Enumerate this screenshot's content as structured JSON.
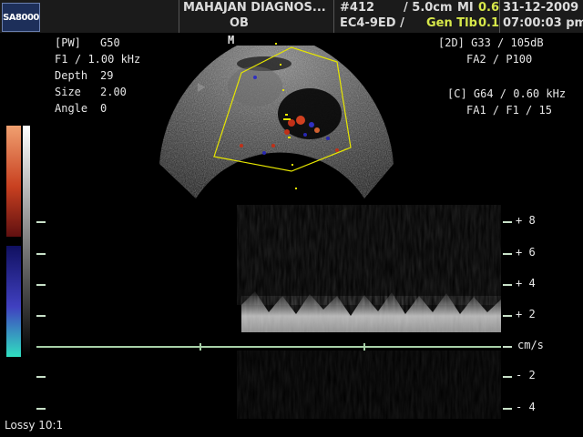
{
  "header": {
    "logo": "SA8000",
    "hospital": "MAHAJAN DIAGNOS...",
    "exam": "OB",
    "frame": "#412",
    "depth_label": "/ 5.0cm",
    "probe": "EC4-9ED /",
    "mi_label": "MI",
    "mi_value": "0.6",
    "tib_label": "Gen Tlb",
    "tib_value": "0.1",
    "date": "31-12-2009",
    "time": "07:00:03 pm"
  },
  "pw_params": [
    {
      "label": "[PW]",
      "value": "G50"
    },
    {
      "label": "F1",
      "value": "/ 1.00 kHz"
    },
    {
      "label": "Depth",
      "value": "29"
    },
    {
      "label": "Size",
      "value": "2.00"
    },
    {
      "label": "Angle",
      "value": "0"
    }
  ],
  "twod_params": {
    "line1": "[2D]  G33 / 105dB",
    "line2": "FA2 / P100"
  },
  "color_params": {
    "line1": "[C]  G64 / 0.60 kHz",
    "line2": "FA1 / F1 / 15"
  },
  "marker": "M",
  "scale": {
    "unit": "cm/s",
    "ticks": [
      {
        "sign": "+",
        "value": "8"
      },
      {
        "sign": "+",
        "value": "6"
      },
      {
        "sign": "+",
        "value": "4"
      },
      {
        "sign": "+",
        "value": "2"
      },
      {
        "sign": "-",
        "value": "2"
      },
      {
        "sign": "-",
        "value": "4"
      }
    ]
  },
  "footer": {
    "compression": "Lossy 10:1"
  },
  "colors": {
    "header_bg": "#1b1b1b",
    "accent_green": "#d7e84a",
    "baseline": "#a8d0a8",
    "sector_outline": "#e6e600"
  }
}
